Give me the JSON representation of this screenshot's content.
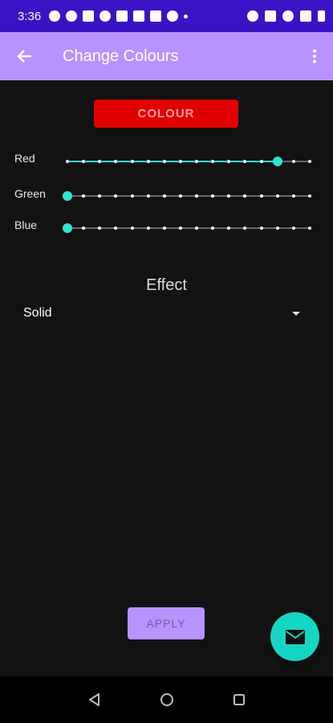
{
  "status_bar": {
    "time": "3:36",
    "icons": [
      "chat-bubble-icon",
      "app-icon",
      "gmail-icon",
      "camera-icon",
      "home-icon",
      "voicemail-icon",
      "f-app-icon",
      "settings-icon",
      "dot-icon"
    ],
    "right_icons": [
      "alarm-icon",
      "nfc-icon",
      "wifi-icon",
      "signal-icon",
      "battery-icon"
    ]
  },
  "app_bar": {
    "title": "Change Colours",
    "color": "#b892ff"
  },
  "colour_button": {
    "label": "COLOUR",
    "color": "#e00000"
  },
  "sliders": [
    {
      "label": "Red",
      "value": 13,
      "max": 15
    },
    {
      "label": "Green",
      "value": 0,
      "max": 15
    },
    {
      "label": "Blue",
      "value": 0,
      "max": 15
    }
  ],
  "effect": {
    "title": "Effect",
    "selected": "Solid"
  },
  "apply_button": {
    "label": "APPLY"
  },
  "accent_color": "#2ee6cf"
}
